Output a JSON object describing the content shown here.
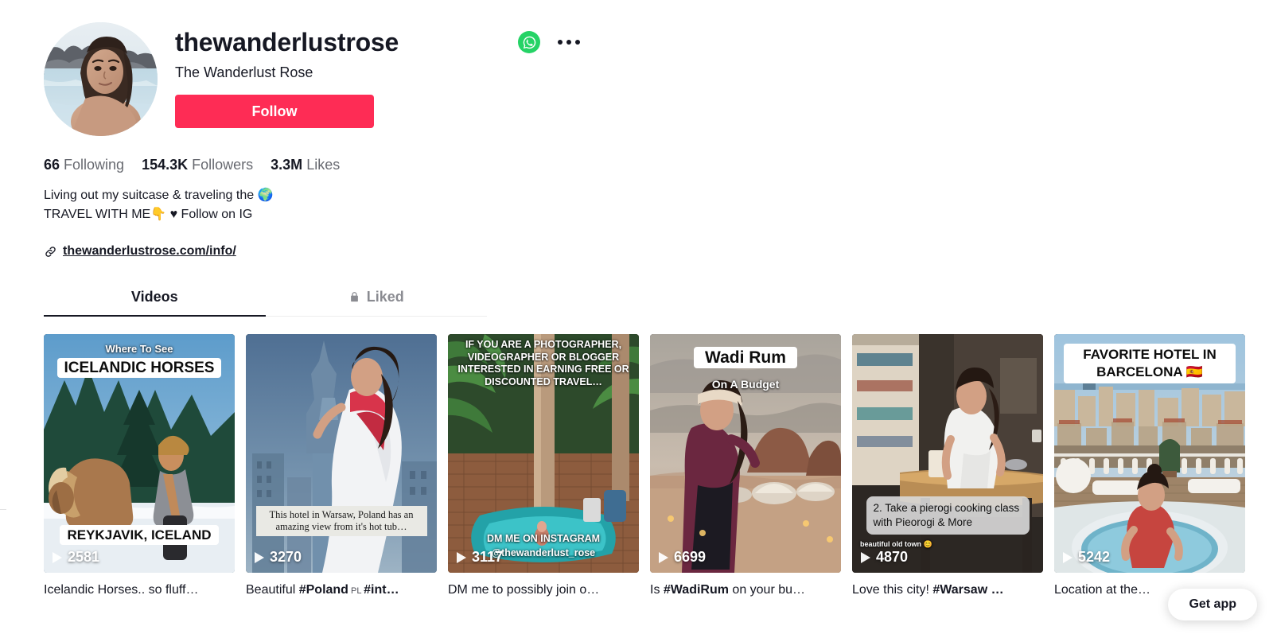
{
  "profile": {
    "username": "thewanderlustrose",
    "nickname": "The Wanderlust Rose",
    "follow_label": "Follow",
    "whatsapp_icon": "whatsapp-icon",
    "more_icon": "more-options-icon",
    "avatar_alt": "profile-avatar"
  },
  "stats": [
    {
      "value": "66",
      "label": "Following"
    },
    {
      "value": "154.3K",
      "label": "Followers"
    },
    {
      "value": "3.3M",
      "label": "Likes"
    }
  ],
  "bio": {
    "line1": "Living out my suitcase & traveling the 🌍",
    "line2": "TRAVEL WITH ME👇 ♥ Follow on IG",
    "link": "thewanderlustrose.com/info/",
    "link_icon": "link-icon"
  },
  "tabs": [
    {
      "label": "Videos",
      "active": true,
      "icon": null
    },
    {
      "label": "Liked",
      "active": false,
      "icon": "lock-icon"
    }
  ],
  "videos": [
    {
      "plays": "2581",
      "caption": "Icelandic Horses.. so fluff…",
      "overlays": {
        "top_small": "Where To See",
        "top_box": "ICELANDIC HORSES",
        "bottom_box": "REYKJAVIK, ICELAND"
      }
    },
    {
      "plays": "3270",
      "caption_pre": "Beautiful ",
      "caption_tag": "#Poland",
      "caption_tiny": " PL ",
      "caption_tag2": "#int…",
      "caption": "Beautiful #Poland PL #int…",
      "overlays": {
        "serif": "This hotel in Warsaw, Poland has an amazing view from it's hot tub…"
      }
    },
    {
      "plays": "3117",
      "caption": "DM me to possibly join o…",
      "overlays": {
        "block": "IF YOU ARE A PHOTOGRAPHER, VIDEOGRAPHER OR BLOGGER INTERESTED IN EARNING FREE OR DISCOUNTED TRAVEL…",
        "bottom1": "DM ME ON INSTAGRAM",
        "bottom2": "@thewanderlust_rose"
      }
    },
    {
      "plays": "6699",
      "caption_pre": "Is ",
      "caption_tag": "#WadiRum",
      "caption_post": " on your bu…",
      "caption": "Is #WadiRum on your bu…",
      "overlays": {
        "top_box": "Wadi Rum",
        "sub": "On A Budget"
      }
    },
    {
      "plays": "4870",
      "caption_pre": "Love this city! ",
      "caption_tag": "#Warsaw …",
      "caption": "Love this city! #Warsaw …",
      "overlays": {
        "gray": "2. Take a pierogi cooking class with Pieorogi & More",
        "small": "beautiful old town 😊"
      }
    },
    {
      "plays": "5242",
      "caption": "Location at the…",
      "overlays": {
        "top_box": "FAVORITE HOTEL IN BARCELONA 🇪🇸"
      }
    }
  ],
  "get_app": {
    "label": "Get app"
  },
  "colors": {
    "accent": "#FE2C55",
    "whatsapp": "#25D366",
    "text": "#161823"
  }
}
